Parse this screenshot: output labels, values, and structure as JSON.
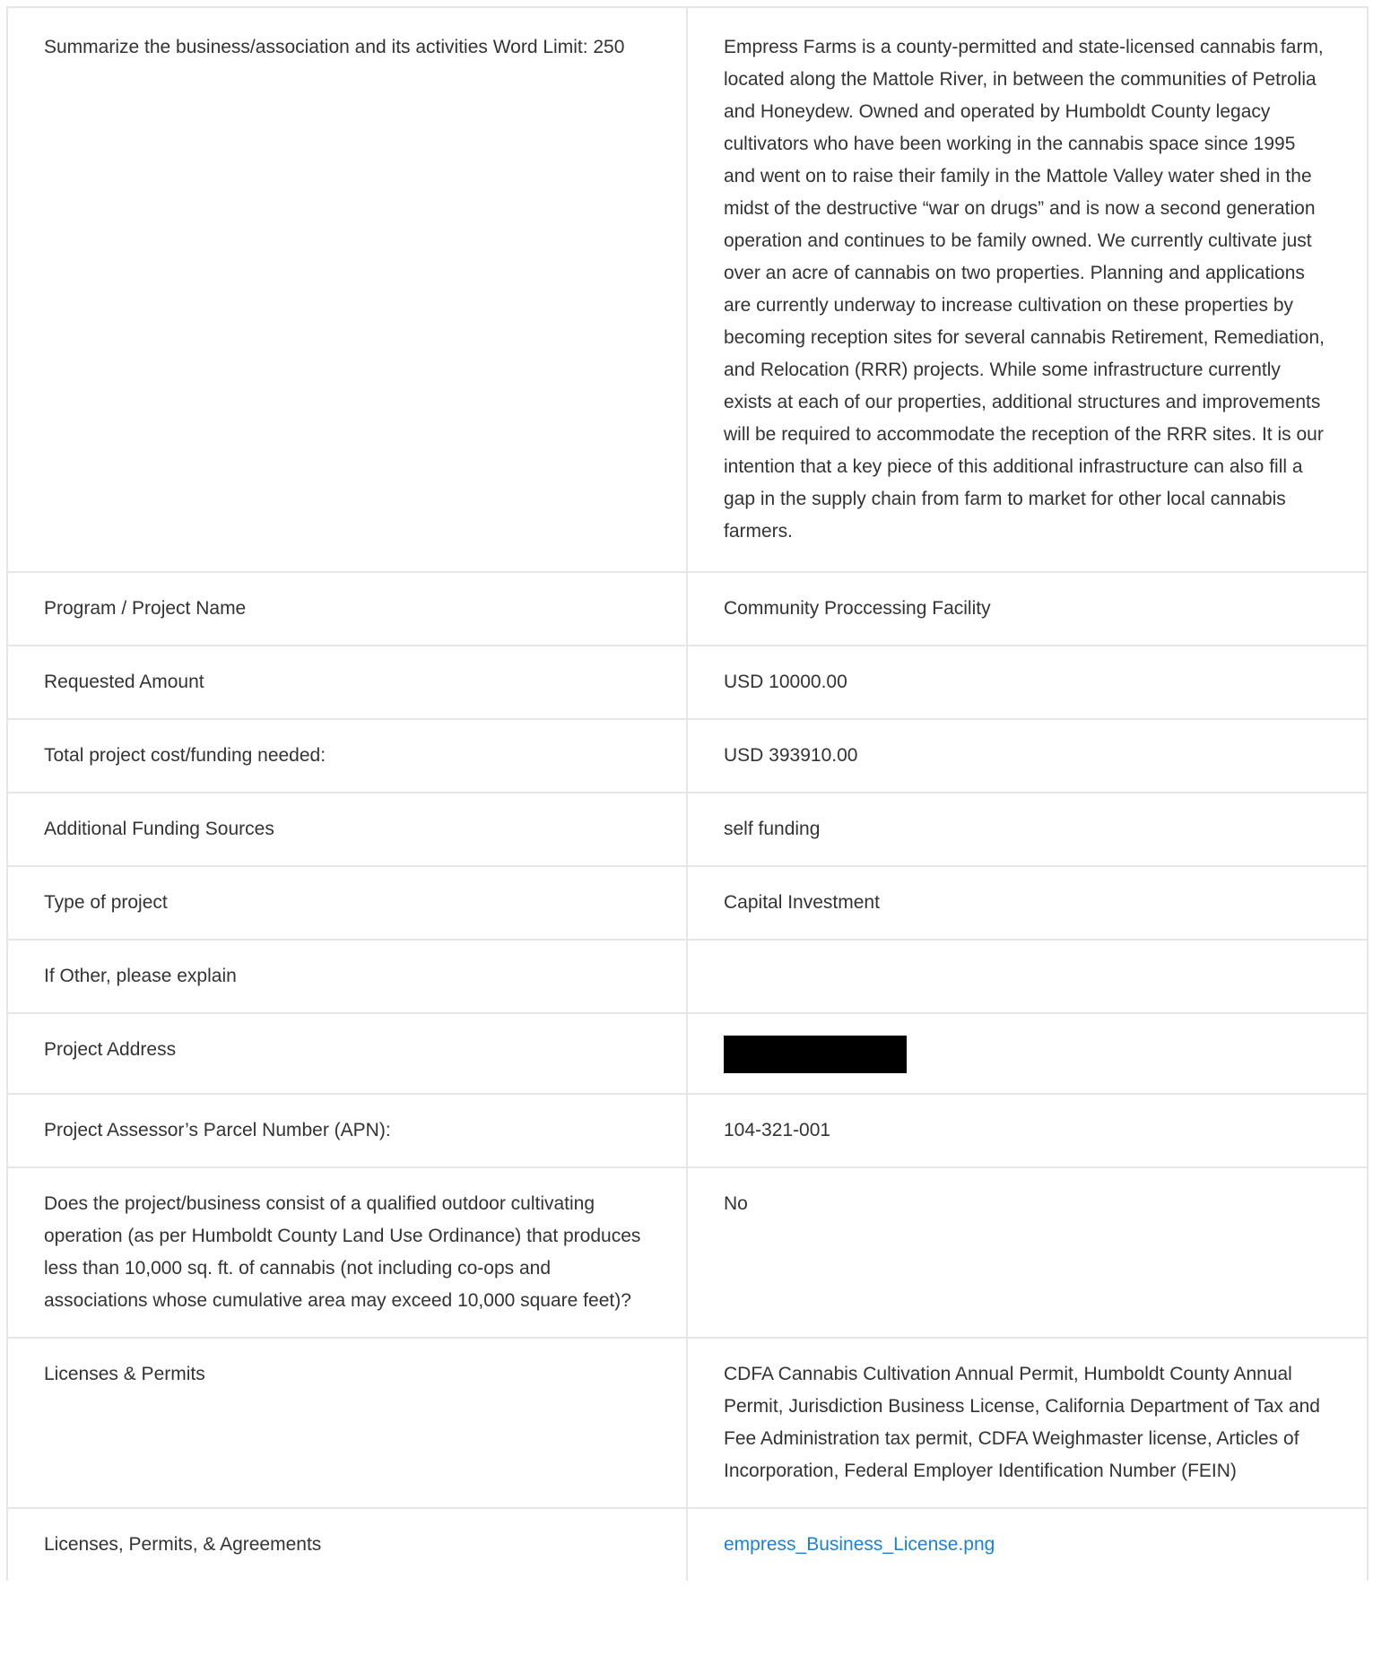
{
  "rows": [
    {
      "label": "Summarize the business/association and its activities Word Limit: 250",
      "value": "Empress Farms is a county-permitted and state-licensed cannabis farm, located along the Mattole River, in between the communities of Petrolia and Honeydew. Owned and operated by Humboldt County legacy cultivators who have been working in the cannabis space since 1995 and went on to raise their family in the Mattole Valley water shed in the midst of the destructive “war on drugs” and is now a second generation operation and continues to be family owned. We currently cultivate just over an acre of cannabis on two properties. Planning and applications are currently underway to increase cultivation on these properties by becoming reception sites for several cannabis Retirement, Remediation, and Relocation (RRR) projects. While some infrastructure currently exists at each of our properties, additional structures and improvements will be required to accommodate the reception of the RRR sites. It is our intention that a key piece of this additional infrastructure can also fill a gap in the supply chain from farm to market for other local cannabis farmers."
    },
    {
      "label": "Program / Project Name",
      "value": "Community Proccessing Facility"
    },
    {
      "label": "Requested Amount",
      "value": "USD 10000.00"
    },
    {
      "label": "Total project cost/funding needed:",
      "value": "USD 393910.00"
    },
    {
      "label": "Additional Funding Sources",
      "value": "self funding"
    },
    {
      "label": "Type of project",
      "value": "Capital Investment"
    },
    {
      "label": "If Other, please explain",
      "value": ""
    },
    {
      "label": "Project Address",
      "value": ""
    },
    {
      "label": "Project Assessor’s Parcel Number (APN):",
      "value": "104-321-001"
    },
    {
      "label": "Does the project/business consist of a qualified outdoor cultivating operation (as per Humboldt County Land Use Ordinance) that produces less than 10,000 sq. ft. of cannabis (not including co-ops and associations whose cumulative area may exceed 10,000 square feet)?",
      "value": "No"
    },
    {
      "label": "Licenses & Permits",
      "value": "CDFA Cannabis Cultivation Annual Permit, Humboldt County Annual Permit, Jurisdiction Business License, California Department of Tax and Fee Administration tax permit, CDFA Weighmaster license, Articles of Incorporation, Federal Employer Identification Number (FEIN)"
    },
    {
      "label": "Licenses, Permits, & Agreements",
      "value": "empress_Business_License.png"
    }
  ],
  "colors": {
    "text": "#333333",
    "border": "#e6e6e6",
    "link": "#1a82d6",
    "redaction": "#000000"
  }
}
